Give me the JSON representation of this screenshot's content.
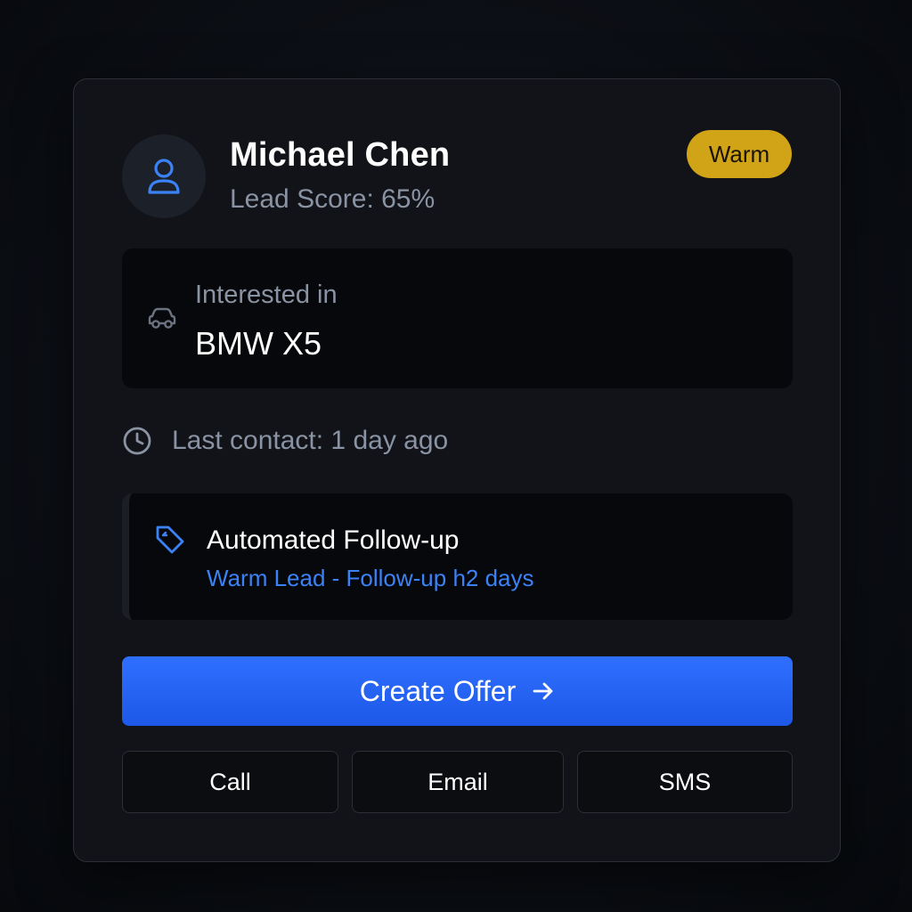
{
  "lead": {
    "name": "Michael Chen",
    "score_text": "Lead Score: 65%",
    "status_badge": "Warm",
    "status_color": "#d1a317"
  },
  "interest": {
    "label": "Interested in",
    "vehicle": "BMW X5",
    "icon": "car-icon"
  },
  "contact": {
    "last_contact": "Last contact: 1 day ago",
    "icon": "clock-icon"
  },
  "automation": {
    "title": "Automated Follow-up",
    "subtitle": "Warm Lead - Follow-up h2 days",
    "icon": "tag-icon",
    "accent_color": "#3b82f6"
  },
  "actions": {
    "primary_label": "Create Offer",
    "primary_color": "#2563eb",
    "secondary": {
      "call": "Call",
      "email": "Email",
      "sms": "SMS"
    }
  }
}
